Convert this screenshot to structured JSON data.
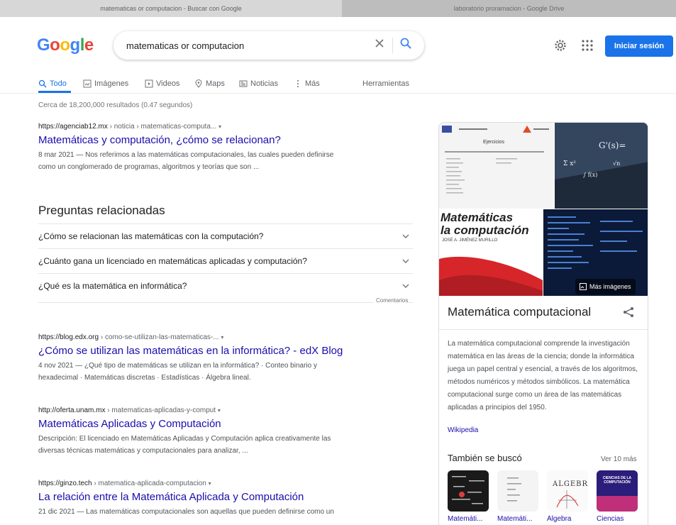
{
  "browser": {
    "tabs": [
      {
        "label": "matematicas or computacion - Buscar con Google"
      },
      {
        "label": "laboratorio proramacion - Google Drive"
      }
    ]
  },
  "header": {
    "logo": [
      "G",
      "o",
      "o",
      "g",
      "l",
      "e"
    ],
    "search_value": "matematicas or computacion",
    "signin_label": "Iniciar sesión",
    "colors": {
      "blue": "#4285f4",
      "red": "#ea4335",
      "yellow": "#fbbc05",
      "green": "#34a853",
      "accent": "#1a73e8"
    }
  },
  "nav": {
    "items": [
      {
        "label": "Todo",
        "icon": "search-icon"
      },
      {
        "label": "Imágenes",
        "icon": "image-icon"
      },
      {
        "label": "Videos",
        "icon": "video-icon"
      },
      {
        "label": "Maps",
        "icon": "location-icon"
      },
      {
        "label": "Noticias",
        "icon": "news-icon"
      },
      {
        "label": "Más",
        "icon": "more-vert-icon"
      }
    ],
    "tools": "Herramientas"
  },
  "stats": "Cerca de 18,200,000 resultados (0.47 segundos)",
  "results": [
    {
      "url": "https://agenciab12.mx",
      "path": " › noticia › matematicas-computa...",
      "title": "Matemáticas y computación, ¿cómo se relacionan?",
      "snippet_line1": "8 mar 2021 — Nos referimos a las matemáticas computacionales, las cuales pueden definirse",
      "snippet_line2": "como un conglomerado de programas, algoritmos y teorías que son ..."
    },
    {
      "url": "https://blog.edx.org",
      "path": " › como-se-utilizan-las-matematicas-...",
      "title": "¿Cómo se utilizan las matemáticas en la informática? - edX Blog",
      "snippet_line1": "4 nov 2021 — ¿Qué tipo de matemáticas se utilizan en la informática? · Conteo binario y",
      "snippet_line2": "hexadecimal · Matemáticas discretas · Estadísticas · Álgebra lineal."
    },
    {
      "url": "http://oferta.unam.mx",
      "path": " › matematicas-aplicadas-y-comput",
      "title": "Matemáticas Aplicadas y Computación",
      "snippet_line1": "Descripción: El licenciado en Matemáticas Aplicadas y Computación aplica creativamente las",
      "snippet_line2": "diversas técnicas matemáticas y computacionales para analizar, ..."
    },
    {
      "url": "https://ginzo.tech",
      "path": " › matematica-aplicada-computacion",
      "title": "La relación entre la Matemática Aplicada y Computación",
      "snippet_line1": "21 dic 2021 — Las matemáticas computacionales son aquellas que pueden definirse como un",
      "snippet_line2": ""
    }
  ],
  "paa": {
    "title": "Preguntas relacionadas",
    "questions": [
      "¿Cómo se relacionan las matemáticas con la computación?",
      "¿Cuánto gana un licenciado en matemáticas aplicadas y computación?",
      "¿Qué es la matemática en informática?"
    ],
    "feedback": "Comentarios"
  },
  "knowledge_panel": {
    "title": "Matemática computacional",
    "book_title_1": "Matemáticas",
    "book_title_2": "la computación",
    "book_author": "JOSÉ A. JIMÉNEZ MURILLO",
    "worksheet_header": "Ejercicios",
    "more_images": "Más imágenes",
    "description": "La matemática computacional comprende la investigación matemática en las áreas de la ciencia; donde la informática juega un papel central y esencial, a través de los algoritmos, métodos numéricos y métodos simbólicos. La matemática computacional surge como un área de las matemáticas aplicadas a principios del 1950.",
    "source": "Wikipedia",
    "also_searched": "También se buscó",
    "see_more": "Ver 10 más",
    "related": [
      {
        "label": "Matemáti..."
      },
      {
        "label": "Matemáti..."
      },
      {
        "label": "Álgebra"
      },
      {
        "label": "Ciencias"
      }
    ],
    "algebra_text": "ALGEBRA",
    "ciencias_text": "CIENCIAS DE LA COMPUTACIÓN"
  }
}
